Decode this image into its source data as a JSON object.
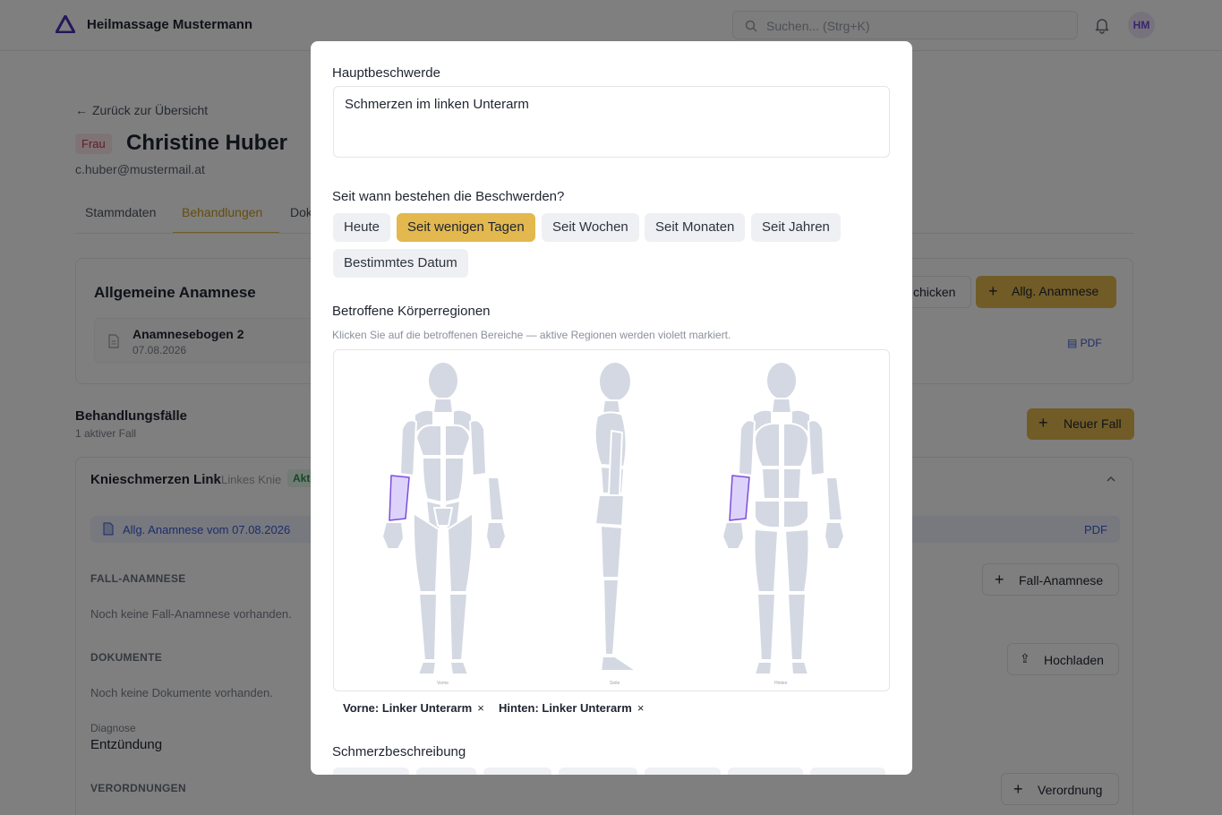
{
  "app": {
    "brand": "Heilmassage Mustermann",
    "search_placeholder": "Suchen... (Strg+K)",
    "avatar_initials": "HM",
    "accent_color": "#e2b84f",
    "highlight_color": "#8b5cf6"
  },
  "patient": {
    "back_label": "Zurück zur Übersicht",
    "gender_badge": "Frau",
    "name": "Christine Huber",
    "email": "c.huber@mustermail.at",
    "tabs": [
      "Stammdaten",
      "Behandlungen",
      "Dok"
    ]
  },
  "anamnese_card": {
    "title": "Allgemeine Anamnese",
    "doc_name": "Anamnesebogen 2",
    "doc_date": "07.08.2026",
    "send_button": "chicken",
    "new_button": "Allg. Anamnese",
    "pdf_label": "PDF"
  },
  "cases": {
    "title": "Behandlungsfälle",
    "subtitle": "1 aktiver Fall",
    "new_case_button": "Neuer Fall",
    "case": {
      "title": "Knieschmerzen Link",
      "location": "Linkes Knie",
      "badge": "Akt",
      "allg_link": "Allg. Anamnese vom 07.08.2026",
      "pdf_label": "PDF",
      "fall_anamnese_heading": "FALL-ANAMNESE",
      "fall_anamnese_empty": "Noch keine Fall-Anamnese vorhanden.",
      "fall_anamnese_button": "Fall-Anamnese",
      "documents_heading": "DOKUMENTE",
      "documents_empty": "Noch keine Dokumente vorhanden.",
      "upload_button": "Hochladen",
      "diagnosis_label": "Diagnose",
      "diagnosis_value": "Entzündung",
      "prescriptions_heading": "VERORDNUNGEN",
      "prescription_button": "Verordnung"
    }
  },
  "modal": {
    "complaint_label": "Hauptbeschwerde",
    "complaint_value": "Schmerzen im linken Unterarm",
    "since_label": "Seit wann bestehen die Beschwerden?",
    "since_options": [
      "Heute",
      "Seit wenigen Tagen",
      "Seit Wochen",
      "Seit Monaten",
      "Seit Jahren",
      "Bestimmtes Datum"
    ],
    "since_selected": "Seit wenigen Tagen",
    "regions_label": "Betroffene Körperregionen",
    "regions_hint": "Klicken Sie auf die betroffenen Bereiche — aktive Regionen werden violett markiert.",
    "views": [
      "Vorne",
      "Seite",
      "Hinten"
    ],
    "selected_regions": [
      "Vorne: Linker Unterarm",
      "Hinten: Linker Unterarm"
    ],
    "remove_glyph": "×",
    "pain_label": "Schmerzbeschreibung"
  }
}
